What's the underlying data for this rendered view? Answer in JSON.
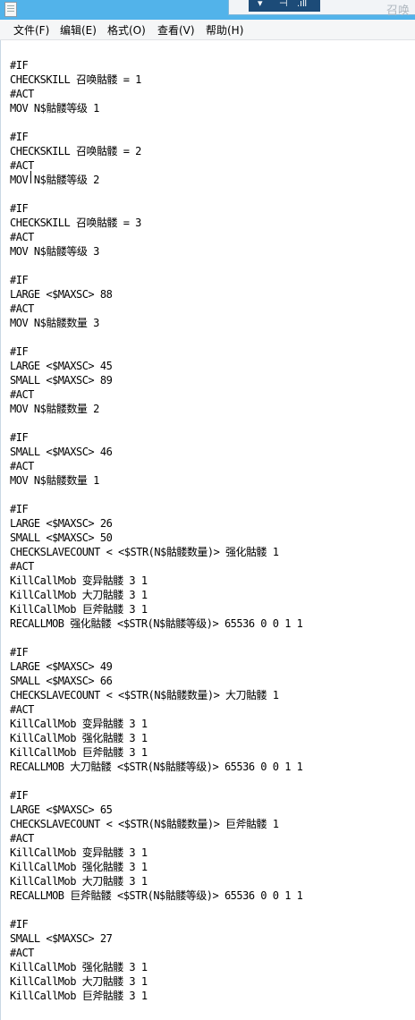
{
  "window": {
    "taskbar_glyphs": [
      "▾",
      "⊣",
      ".ıll"
    ],
    "ghost_title": "召唤"
  },
  "menu": {
    "items": [
      {
        "label": "文件(F)"
      },
      {
        "label": "编辑(E)"
      },
      {
        "label": "格式(O)"
      },
      {
        "label": "查看(V)"
      },
      {
        "label": "帮助(H)"
      }
    ]
  },
  "editor": {
    "content": "#IF\nCHECKSKILL 召唤骷髅 = 1\n#ACT\nMOV N$骷髅等级 1\n\n#IF\nCHECKSKILL 召唤骷髅 = 2\n#ACT\nMOV N$骷髅等级 2\n\n#IF\nCHECKSKILL 召唤骷髅 = 3\n#ACT\nMOV N$骷髅等级 3\n\n#IF\nLARGE <$MAXSC> 88\n#ACT\nMOV N$骷髅数量 3\n\n#IF\nLARGE <$MAXSC> 45\nSMALL <$MAXSC> 89\n#ACT\nMOV N$骷髅数量 2\n\n#IF\nSMALL <$MAXSC> 46\n#ACT\nMOV N$骷髅数量 1\n\n#IF\nLARGE <$MAXSC> 26\nSMALL <$MAXSC> 50\nCHECKSLAVECOUNT < <$STR(N$骷髅数量)> 强化骷髅 1\n#ACT\nKillCallMob 变异骷髅 3 1\nKillCallMob 大刀骷髅 3 1\nKillCallMob 巨斧骷髅 3 1\nRECALLMOB 强化骷髅 <$STR(N$骷髅等级)> 65536 0 0 1 1\n\n#IF\nLARGE <$MAXSC> 49\nSMALL <$MAXSC> 66\nCHECKSLAVECOUNT < <$STR(N$骷髅数量)> 大刀骷髅 1\n#ACT\nKillCallMob 变异骷髅 3 1\nKillCallMob 强化骷髅 3 1\nKillCallMob 巨斧骷髅 3 1\nRECALLMOB 大刀骷髅 <$STR(N$骷髅等级)> 65536 0 0 1 1\n\n#IF\nLARGE <$MAXSC> 65\nCHECKSLAVECOUNT < <$STR(N$骷髅数量)> 巨斧骷髅 1\n#ACT\nKillCallMob 变异骷髅 3 1\nKillCallMob 强化骷髅 3 1\nKillCallMob 大刀骷髅 3 1\nRECALLMOB 巨斧骷髅 <$STR(N$骷髅等级)> 65536 0 0 1 1\n\n#IF\nSMALL <$MAXSC> 27\n#ACT\nKillCallMob 强化骷髅 3 1\nKillCallMob 大刀骷髅 3 1\nKillCallMob 巨斧骷髅 3 1"
  }
}
